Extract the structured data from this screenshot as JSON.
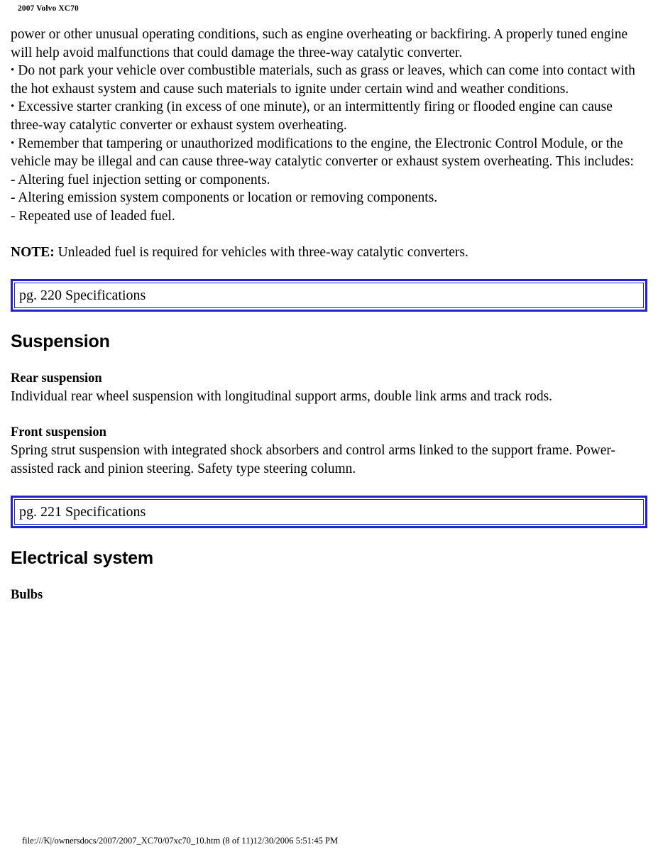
{
  "document": {
    "header": "2007 Volvo XC70",
    "footer": "file:///K|/ownersdocs/2007/2007_XC70/07xc70_10.htm (8 of 11)12/30/2006 5:51:45 PM"
  },
  "colors": {
    "link_box_border": "#2222cc",
    "text": "#000000",
    "page_background": "#ffffff"
  },
  "content": {
    "continued_paragraph": "power or other unusual operating conditions, such as engine overheating or backfiring. A properly tuned engine will help avoid malfunctions that could damage the three-way catalytic converter.",
    "bullets": [
      {
        "marker": "•",
        "text": "Do not park your vehicle over combustible materials, such as grass or leaves, which can come into contact with the hot exhaust system and cause such materials to ignite under certain wind and weather conditions."
      },
      {
        "marker": "•",
        "text": "Excessive starter cranking (in excess of one minute), or an intermittently firing or flooded engine can cause three-way catalytic converter or exhaust system overheating."
      },
      {
        "marker": "•",
        "text": "Remember that tampering or unauthorized modifications to the engine, the Electronic Control Module, or the vehicle may be illegal and can cause three-way catalytic converter or exhaust system overheating. This includes:"
      }
    ],
    "dash_items": [
      "- Altering fuel injection setting or components.",
      "- Altering emission system components or location or removing components.",
      "- Repeated use of leaded fuel."
    ],
    "note": {
      "label": "NOTE:",
      "text": " Unleaded fuel is required for vehicles with three-way catalytic converters."
    }
  },
  "link_boxes": [
    {
      "label": "pg. 220 Specifications"
    },
    {
      "label": "pg. 221 Specifications"
    }
  ],
  "sections": [
    {
      "heading": "Suspension",
      "subsections": [
        {
          "title": "Rear suspension",
          "body": "Individual rear wheel suspension with longitudinal support arms, double link arms and track rods."
        },
        {
          "title": "Front suspension",
          "body": "Spring strut suspension with integrated shock absorbers and control arms linked to the support frame. Power-assisted rack and pinion steering. Safety type steering column."
        }
      ]
    },
    {
      "heading": "Electrical system",
      "subsections": [
        {
          "title": "Bulbs",
          "body": ""
        }
      ]
    }
  ]
}
